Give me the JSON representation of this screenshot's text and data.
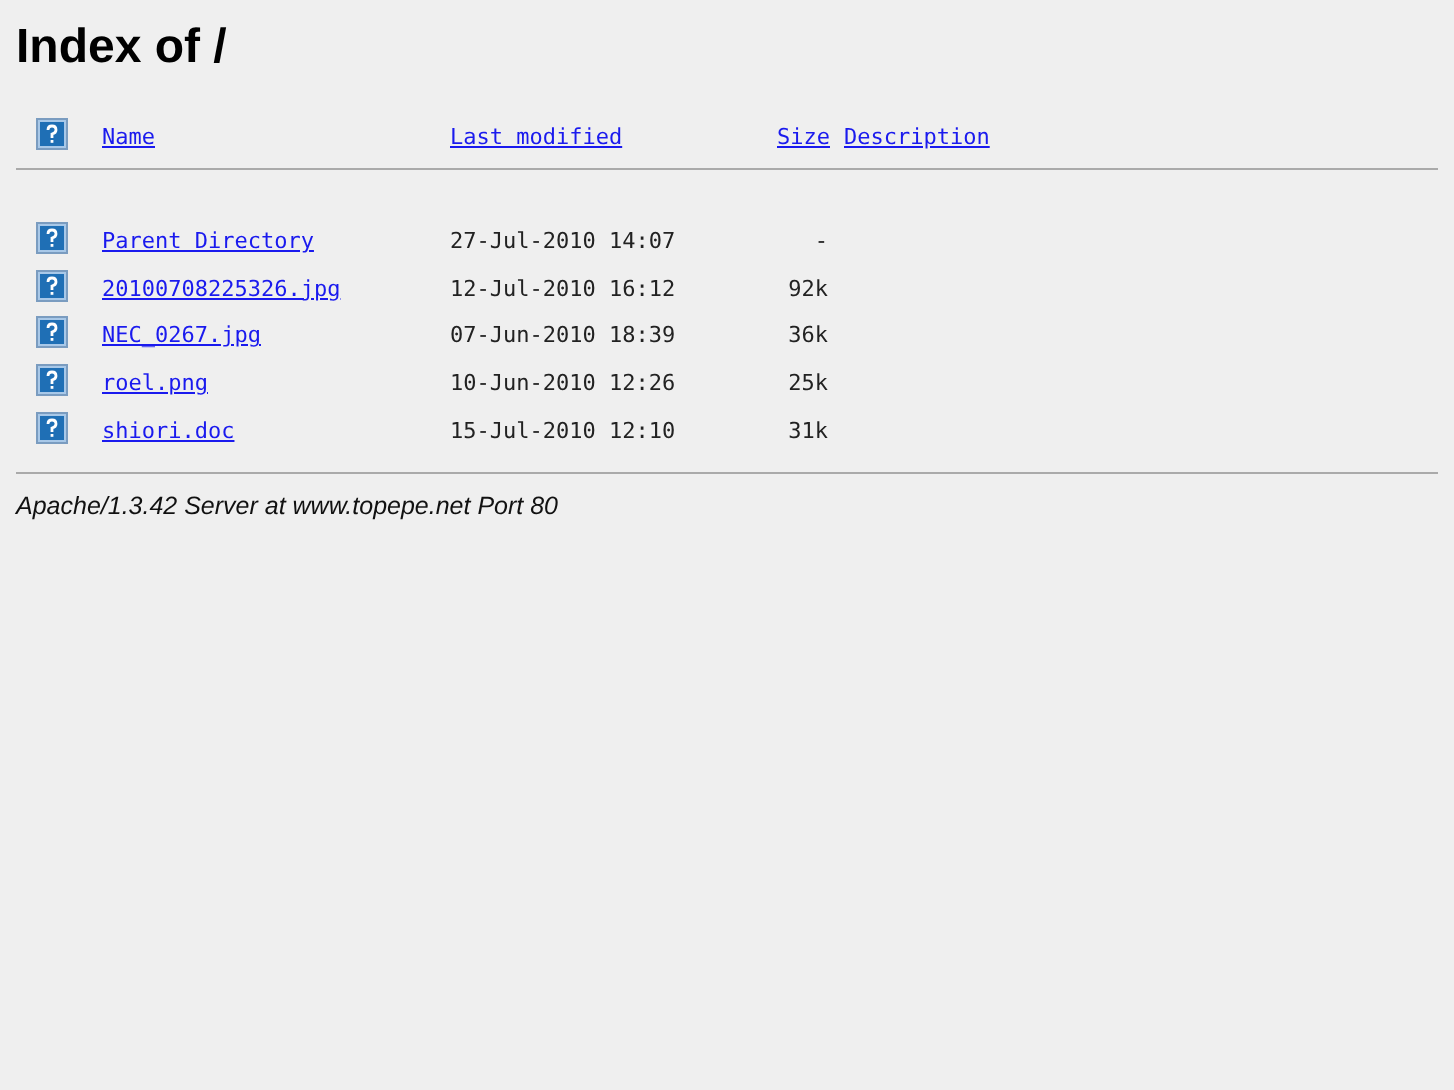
{
  "title": "Index of /",
  "columns": [
    "Name",
    "Last modified",
    "Size",
    "Description"
  ],
  "rows": [
    {
      "name": "Parent Directory",
      "modified": "27-Jul-2010 14:07",
      "size": "-"
    },
    {
      "name": "20100708225326.jpg",
      "modified": "12-Jul-2010 16:12",
      "size": "92k"
    },
    {
      "name": "NEC_0267.jpg",
      "modified": "07-Jun-2010 18:39",
      "size": "36k"
    },
    {
      "name": "roel.png",
      "modified": "10-Jun-2010 12:26",
      "size": "25k"
    },
    {
      "name": "shiori.doc",
      "modified": "15-Jul-2010 12:10",
      "size": "31k"
    }
  ],
  "footer": "Apache/1.3.42 Server at www.topepe.net Port 80"
}
